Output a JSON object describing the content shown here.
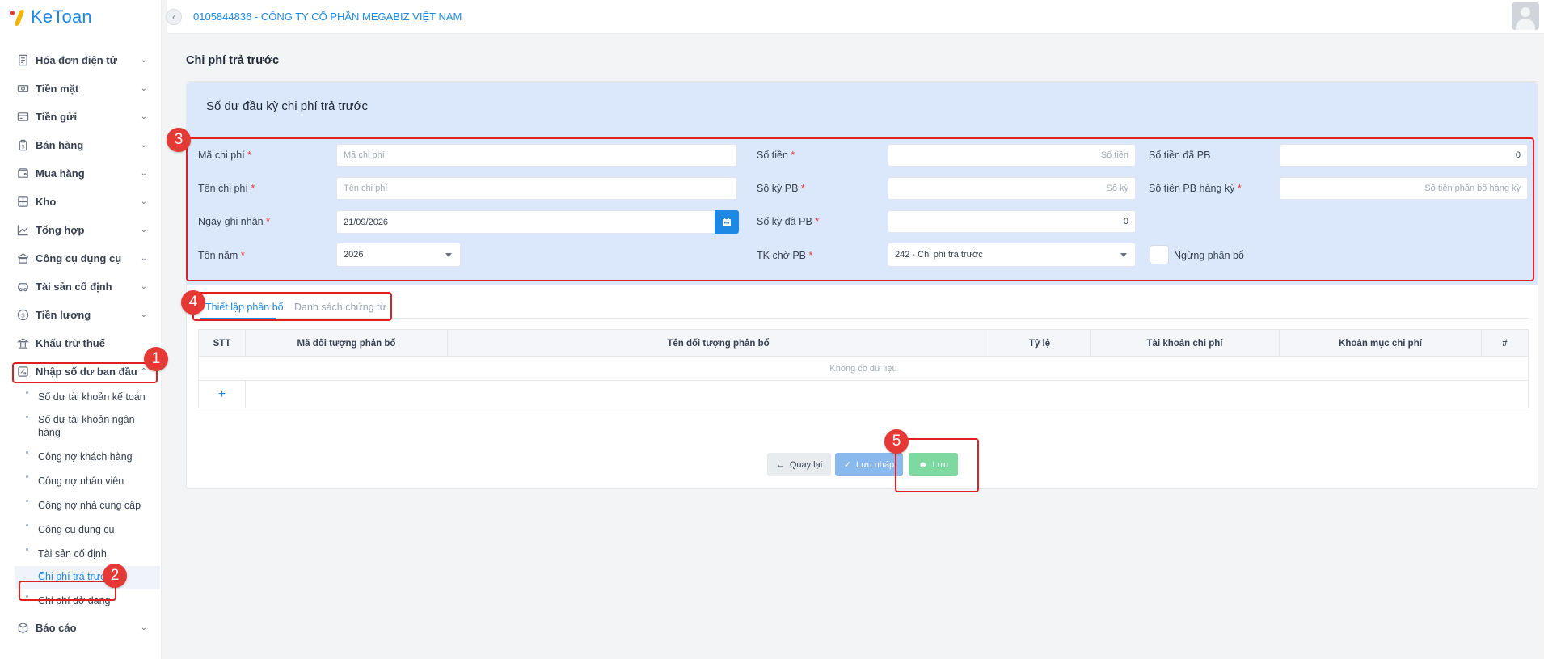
{
  "app": {
    "logo_text": "KeToan",
    "company": "0105844836 - CÔNG TY CỔ PHẦN MEGABIZ VIỆT NAM"
  },
  "sidebar": {
    "items": [
      {
        "label": "Hóa đơn điện tử",
        "icon": "invoice-icon"
      },
      {
        "label": "Tiền mặt",
        "icon": "cash-icon"
      },
      {
        "label": "Tiền gửi",
        "icon": "bank-icon"
      },
      {
        "label": "Bán hàng",
        "icon": "sales-icon"
      },
      {
        "label": "Mua hàng",
        "icon": "purchase-icon"
      },
      {
        "label": "Kho",
        "icon": "warehouse-icon"
      },
      {
        "label": "Tổng hợp",
        "icon": "chart-icon"
      },
      {
        "label": "Công cụ dụng cụ",
        "icon": "tools-icon"
      },
      {
        "label": "Tài sản cố định",
        "icon": "asset-icon"
      },
      {
        "label": "Tiền lương",
        "icon": "salary-icon"
      },
      {
        "label": "Khấu trừ thuế",
        "icon": "tax-icon"
      },
      {
        "label": "Nhập số dư ban đầu",
        "icon": "balance-icon"
      }
    ],
    "sub_items": [
      "Số dư tài khoản kế toán",
      "Số dư tài khoản ngân hàng",
      "Công nợ khách hàng",
      "Công nợ nhân viên",
      "Công nợ nhà cung cấp",
      "Công cụ dụng cụ",
      "Tài sản cố định",
      "Chi phí trả trước",
      "Chi phí dở dang"
    ],
    "active_sub": "Chi phí trả trước",
    "bottom_item": {
      "label": "Báo cáo",
      "icon": "report-icon"
    }
  },
  "page": {
    "title": "Chi phí trả trước",
    "panel_title": "Số dư đầu kỳ chi phí trả trước"
  },
  "form": {
    "ma_chi_phi": {
      "label": "Mã chi phí",
      "placeholder": "Mã chi phí",
      "value": ""
    },
    "ten_chi_phi": {
      "label": "Tên chi phí",
      "placeholder": "Tên chi phí",
      "value": ""
    },
    "ngay_ghi_nhan": {
      "label": "Ngày ghi nhận",
      "value": "21/09/2026"
    },
    "ton_nam": {
      "label": "Tồn năm",
      "value": "2026"
    },
    "so_tien": {
      "label": "Số tiền",
      "placeholder": "Số tiền",
      "value": ""
    },
    "so_ky_pb": {
      "label": "Số kỳ PB",
      "placeholder": "Số kỳ",
      "value": ""
    },
    "so_ky_da_pb": {
      "label": "Số kỳ đã PB",
      "value": "0"
    },
    "tk_cho_pb": {
      "label": "TK chờ PB",
      "value": "242 - Chi phí trả trước"
    },
    "so_tien_da_pb": {
      "label": "Số tiền đã PB",
      "value": "0"
    },
    "so_tien_pb_hang_ky": {
      "label": "Số tiền PB hàng kỳ",
      "placeholder": "Số tiền phân bổ hàng kỳ",
      "value": ""
    },
    "ngung_phan_bo": {
      "label": "Ngừng phân bổ",
      "checked": false
    },
    "required_mark": "*"
  },
  "tabs": [
    {
      "label": "Thiết lập phân bổ",
      "active": true
    },
    {
      "label": "Danh sách chứng từ",
      "active": false
    }
  ],
  "table": {
    "columns": [
      "STT",
      "Mã đối tượng phân bổ",
      "Tên đối tượng phân bổ",
      "Tỷ lệ",
      "Tài khoản chi phí",
      "Khoản mục chi phí",
      "#"
    ],
    "empty_text": "Không có dữ liệu",
    "add_label": "+"
  },
  "buttons": {
    "back": "Quay lại",
    "draft": "Lưu nháp",
    "save": "Lưu"
  },
  "annotations": [
    "1",
    "2",
    "3",
    "4",
    "5"
  ],
  "colors": {
    "accent": "#1e88e5",
    "annotation": "#e53935",
    "panel_bg": "#dbe8fb",
    "save_green": "#7ed9a0"
  }
}
